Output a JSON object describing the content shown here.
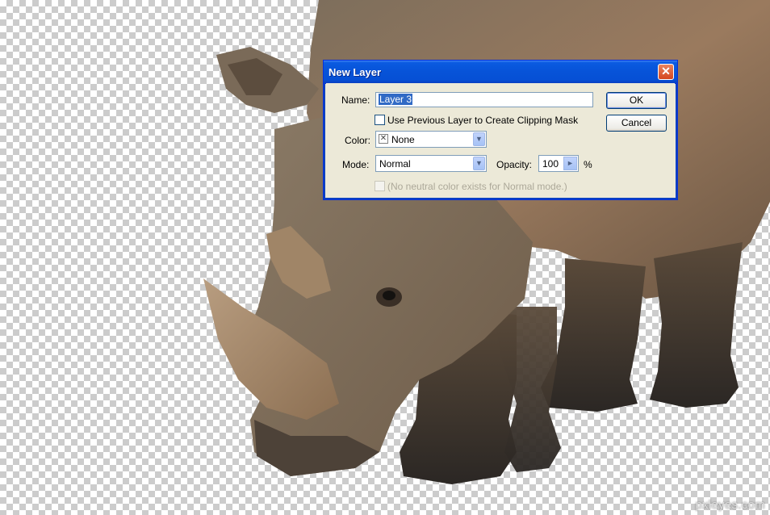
{
  "watermark": "pxleyes.com",
  "dialog": {
    "title": "New Layer",
    "name_label": "Name:",
    "name_value": "Layer 3",
    "clip_label": "Use Previous Layer to Create Clipping Mask",
    "color_label": "Color:",
    "color_value": "None",
    "mode_label": "Mode:",
    "mode_value": "Normal",
    "opacity_label": "Opacity:",
    "opacity_value": "100",
    "opacity_unit": "%",
    "neutral_label": "(No neutral color exists for Normal mode.)",
    "ok_label": "OK",
    "cancel_label": "Cancel",
    "close_glyph": "✕"
  },
  "colors": {
    "titlebar": "#0753d8",
    "dialog_bg": "#ece9d8",
    "selection": "#316ac5",
    "close_button": "#d4461f"
  }
}
